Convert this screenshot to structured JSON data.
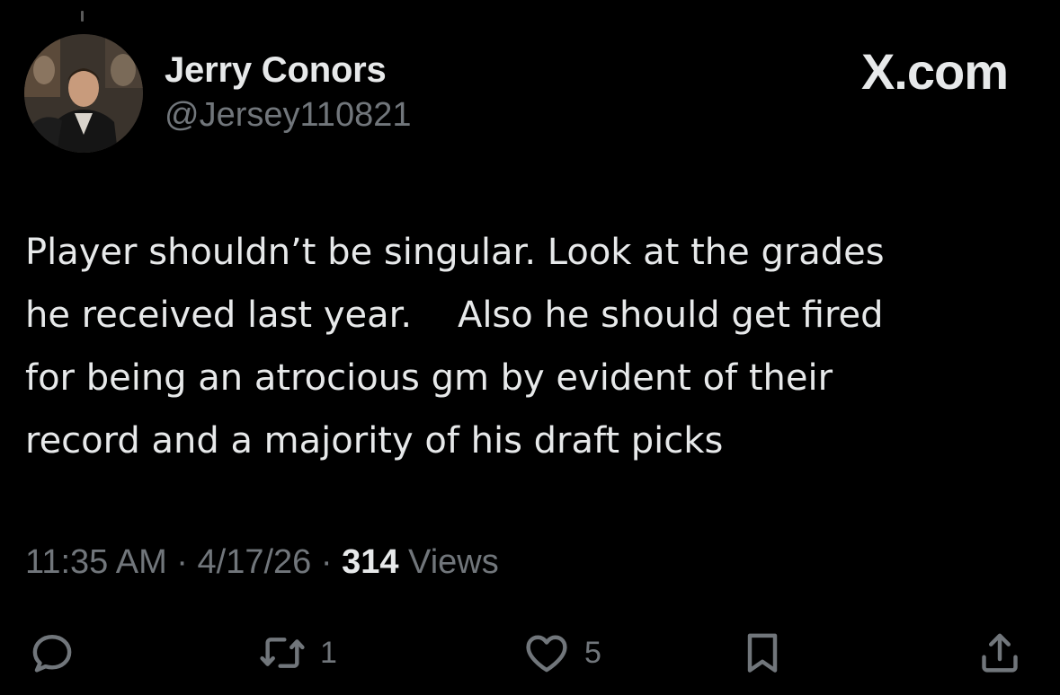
{
  "author": {
    "name": "Jerry Conors",
    "handle": "@Jersey110821"
  },
  "brand": "X.com",
  "post": {
    "text": "Player shouldn’t be singular. Look at the grades\nhe received last year.    Also he should get fired\nfor being an atrocious gm by evident of their\nrecord and a majority of his draft picks"
  },
  "meta": {
    "time": "11:35 AM",
    "sep1": " · ",
    "date": "4/17/26",
    "sep2": " · ",
    "views_count": "314",
    "views_label": " Views"
  },
  "actions": {
    "reply_icon": "reply-icon",
    "repost_icon": "repost-icon",
    "repost_count": "1",
    "like_icon": "heart-icon",
    "like_count": "5",
    "bookmark_icon": "bookmark-icon",
    "share_icon": "share-icon"
  },
  "colors": {
    "background": "#000000",
    "text_primary": "#e7e9ea",
    "text_secondary": "#71767b"
  }
}
